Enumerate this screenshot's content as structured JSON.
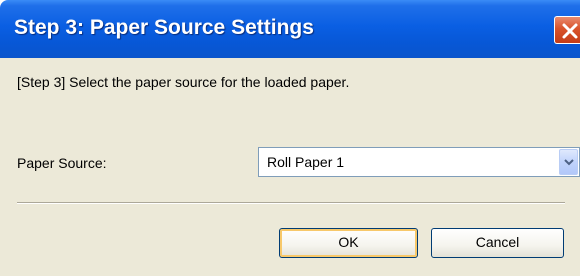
{
  "window": {
    "title": "Step 3: Paper Source Settings",
    "close_icon": "close-icon",
    "accent_color": "#0a5fe3"
  },
  "instruction": "[Step 3] Select the paper source for the loaded paper.",
  "paper_source": {
    "label": "Paper Source:",
    "selected": "Roll Paper 1"
  },
  "buttons": {
    "ok": "OK",
    "cancel": "Cancel"
  }
}
